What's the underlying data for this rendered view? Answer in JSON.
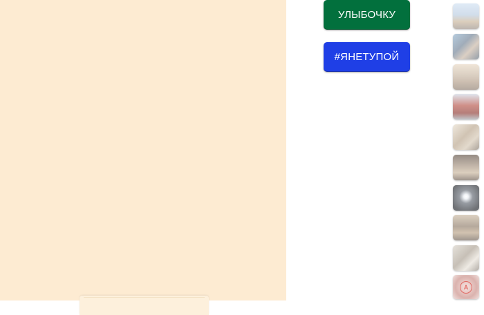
{
  "buttons": {
    "smile_label": "УЛЫБОЧКУ",
    "smile_color": "#02703d",
    "not_stupid_label": "#ЯНЕТУПОЙ",
    "not_stupid_color": "#1f3fe6"
  },
  "panel": {
    "background_color": "#fdebd2"
  },
  "thumbnails": [
    {
      "icon": "city-skyline-photo-icon"
    },
    {
      "icon": "portrait-photo-icon"
    },
    {
      "icon": "street-photo-icon"
    },
    {
      "icon": "kremlin-photo-icon"
    },
    {
      "icon": "interior-photo-icon"
    },
    {
      "icon": "room-photo-icon"
    },
    {
      "icon": "light-photo-icon"
    },
    {
      "icon": "hall-photo-icon"
    },
    {
      "icon": "kitchen-photo-icon"
    },
    {
      "icon": "emblem-icon",
      "emblem_letter": "A"
    }
  ]
}
